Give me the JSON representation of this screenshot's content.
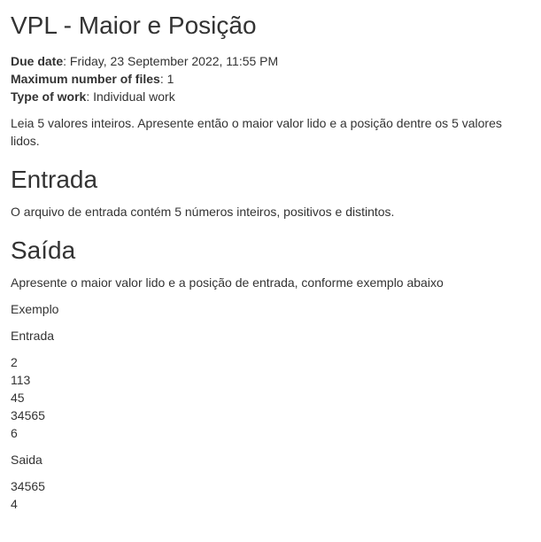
{
  "title": "VPL - Maior e Posição",
  "meta": [
    {
      "label": "Due date",
      "value": "Friday, 23 September 2022, 11:55 PM"
    },
    {
      "label": "Maximum number of files",
      "value": "1"
    },
    {
      "label": "Type of work",
      "value": "Individual work"
    }
  ],
  "intro": "Leia 5 valores inteiros. Apresente então o maior valor lido e a posição dentre os 5 valores lidos.",
  "input_heading": "Entrada",
  "input_text": "O arquivo de entrada contém 5 números inteiros, positivos e distintos.",
  "output_heading": "Saída",
  "output_text": "Apresente o maior valor lido e a posição de entrada, conforme exemplo abaixo",
  "example_label": "Exemplo",
  "example_input_label": "Entrada",
  "example_input": [
    "2",
    "113",
    "45",
    "34565",
    "6"
  ],
  "example_output_label": "Saida",
  "example_output": [
    "34565",
    "4"
  ]
}
